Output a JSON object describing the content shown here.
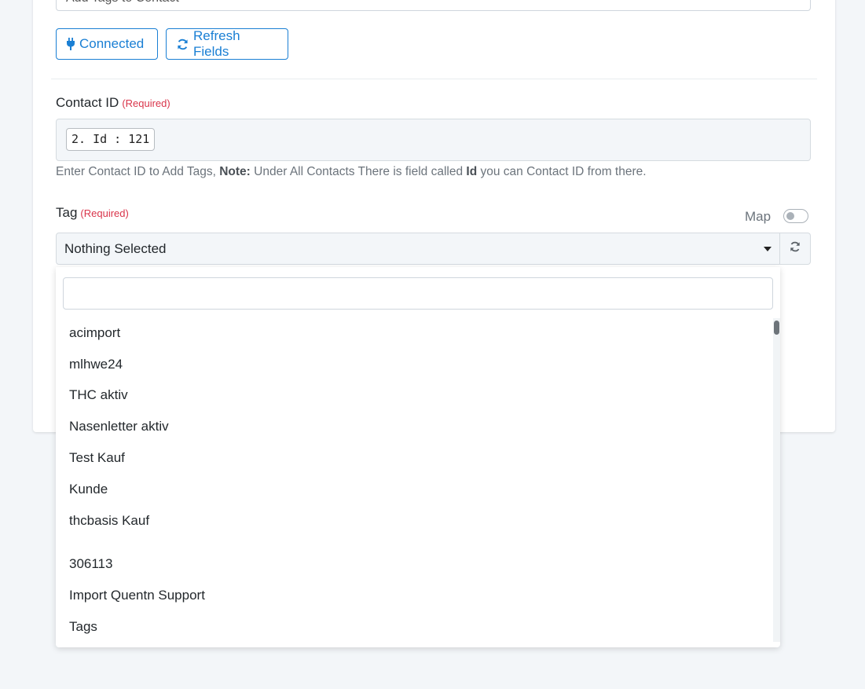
{
  "form": {
    "action_input_value": "Add Tags to Contact",
    "connected_label": "Connected",
    "refresh_fields_label": "Refresh Fields",
    "contact_id": {
      "label": "Contact ID",
      "required": "(Required)",
      "chip": "2. Id : 121",
      "help_prefix": "Enter Contact ID to Add Tags,",
      "help_note": "Note:",
      "help_mid": "Under All Contacts There is field called",
      "help_field": "Id",
      "help_suffix": "you can Contact ID from there."
    },
    "tag": {
      "label": "Tag",
      "required": "(Required)",
      "map_label": "Map",
      "selected": "Nothing Selected",
      "search_placeholder": "",
      "options": [
        "acimport",
        "mlhwe24",
        "THC aktiv",
        "Nasenletter aktiv",
        "Test Kauf",
        "Kunde",
        "thcbasis Kauf",
        "306113",
        "Import Quentn Support",
        "Tags"
      ]
    }
  },
  "colors": {
    "accent": "#1a7fd4",
    "required": "#d9344a",
    "background": "#f3f6f9"
  },
  "icons": {
    "connected": "plug-icon",
    "refresh": "refresh-icon"
  }
}
